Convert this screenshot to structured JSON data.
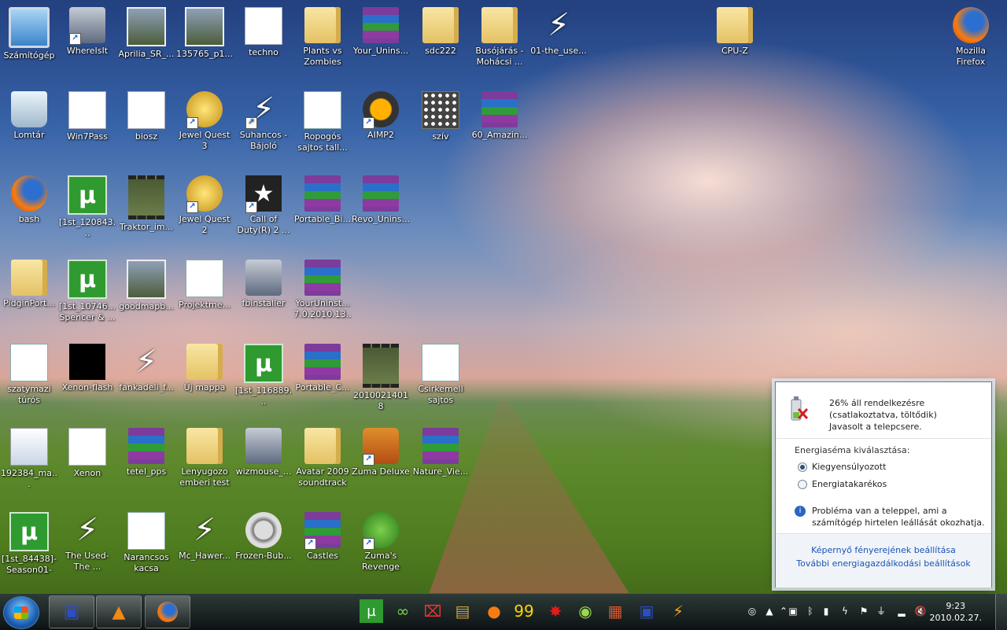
{
  "desktop": {
    "icons": [
      {
        "label": "Számítógép",
        "icon": "computer-icon"
      },
      {
        "label": "WhereIsIt",
        "icon": "disk-app-icon"
      },
      {
        "label": "Aprilia_SR_...",
        "icon": "photo-icon"
      },
      {
        "label": "135765_p1...",
        "icon": "photo-icon"
      },
      {
        "label": "techno",
        "icon": "text-document-icon"
      },
      {
        "label": "Plants vs Zombies",
        "icon": "folder-icon"
      },
      {
        "label": "Your_Unins...",
        "icon": "winrar-archive-icon"
      },
      {
        "label": "sdc222",
        "icon": "folder-icon"
      },
      {
        "label": "Busójárás - Mohácsi ...",
        "icon": "folder-icon"
      },
      {
        "label": "01-the_use...",
        "icon": "winamp-media-icon"
      },
      {
        "label": "CPU-Z",
        "icon": "folder-icon"
      },
      {
        "label": "Mozilla Firefox",
        "icon": "firefox-icon"
      },
      {
        "label": "Lomtár",
        "icon": "recycle-bin-icon"
      },
      {
        "label": "Win7Pass",
        "icon": "text-document-icon"
      },
      {
        "label": "biosz",
        "icon": "text-document-icon"
      },
      {
        "label": "Jewel Quest 3",
        "icon": "jewel-quest-icon"
      },
      {
        "label": "Suhancos - Bájoló",
        "icon": "winamp-media-icon"
      },
      {
        "label": "Ropogós sajtos tall...",
        "icon": "word-document-icon"
      },
      {
        "label": "AIMP2",
        "icon": "aimp-icon"
      },
      {
        "label": "szív",
        "icon": "pattern-image-icon"
      },
      {
        "label": "60_Amazin...",
        "icon": "winrar-archive-icon"
      },
      {
        "label": "bash",
        "icon": "firefox-file-icon"
      },
      {
        "label": "[1st_120843...",
        "icon": "utorrent-icon"
      },
      {
        "label": "Traktor_im...",
        "icon": "video-file-icon"
      },
      {
        "label": "Jewel Quest 2",
        "icon": "jewel-quest-icon"
      },
      {
        "label": "Call of Duty(R) 2 ...",
        "icon": "call-of-duty-icon"
      },
      {
        "label": "Portable_Bi...",
        "icon": "winrar-archive-icon"
      },
      {
        "label": "Revo_Unins...",
        "icon": "winrar-archive-icon"
      },
      {
        "label": "PidginPort...",
        "icon": "folder-icon"
      },
      {
        "label": "[1st_10746... Spencer & ...",
        "icon": "utorrent-icon"
      },
      {
        "label": "goodmapb...",
        "icon": "map-image-icon"
      },
      {
        "label": "Projektme...",
        "icon": "word-document-icon"
      },
      {
        "label": "fbinstaller",
        "icon": "installer-icon"
      },
      {
        "label": "YourUninst... 7.0.2010.13...",
        "icon": "winrar-archive-icon"
      },
      {
        "label": "szatymazi túrós",
        "icon": "word-document-icon"
      },
      {
        "label": "Xenon-flash",
        "icon": "black-image-icon"
      },
      {
        "label": "fankadeli_f...",
        "icon": "winamp-media-icon"
      },
      {
        "label": "Új mappa",
        "icon": "folder-icon"
      },
      {
        "label": "[1st_116889...",
        "icon": "utorrent-icon"
      },
      {
        "label": "Portable_C...",
        "icon": "winrar-archive-icon"
      },
      {
        "label": "20100214018",
        "icon": "video-file-icon"
      },
      {
        "label": "Csirkemell sajtos",
        "icon": "word-document-icon"
      },
      {
        "label": "192384_ma...",
        "icon": "portrait-image-icon"
      },
      {
        "label": "Xenon",
        "icon": "audio-file-icon"
      },
      {
        "label": "tetel_pps",
        "icon": "winrar-archive-icon"
      },
      {
        "label": "Lenyugozo emberi test",
        "icon": "folder-icon"
      },
      {
        "label": "wizmouse_...",
        "icon": "installer-icon"
      },
      {
        "label": "Avatar 2009 soundtrack",
        "icon": "folder-icon"
      },
      {
        "label": "Zuma Deluxe",
        "icon": "zuma-icon"
      },
      {
        "label": "Nature_Vie...",
        "icon": "winrar-archive-icon"
      },
      {
        "label": "[1st_84438]- Season01-S...",
        "icon": "utorrent-icon"
      },
      {
        "label": "The Used-The ...",
        "icon": "winamp-media-icon"
      },
      {
        "label": "Narancsos kacsa",
        "icon": "word-document-icon"
      },
      {
        "label": "Mc_Hawer...",
        "icon": "winamp-media-icon"
      },
      {
        "label": "Frozen-Bub...",
        "icon": "gears-icon"
      },
      {
        "label": "Castles",
        "icon": "winrar-archive-icon"
      },
      {
        "label": "Zuma's Revenge",
        "icon": "zumas-revenge-icon"
      }
    ]
  },
  "taskbar": {
    "start_label": "Start",
    "pinned": [
      {
        "icon": "floppy-save-icon"
      },
      {
        "icon": "vlc-icon"
      },
      {
        "icon": "firefox-icon"
      }
    ],
    "quick_launch": [
      {
        "icon": "utorrent-icon"
      },
      {
        "icon": "infinity-icon"
      },
      {
        "icon": "uninstaller-icon"
      },
      {
        "icon": "archive-icon"
      },
      {
        "icon": "firefox-icon"
      },
      {
        "icon": "monitor-99-icon"
      },
      {
        "icon": "red-splat-icon"
      },
      {
        "icon": "lime-icon"
      },
      {
        "icon": "castle-icon"
      },
      {
        "icon": "floppy-save-icon"
      },
      {
        "icon": "winamp-icon"
      }
    ],
    "tray": [
      {
        "icon": "network-status-icon"
      },
      {
        "icon": "vlc-tray-icon"
      },
      {
        "icon": "hidden-icons-icon"
      },
      {
        "icon": "device-icon"
      },
      {
        "icon": "bluetooth-icon"
      },
      {
        "icon": "battery-plug-icon"
      },
      {
        "icon": "lightning-icon"
      },
      {
        "icon": "action-center-flag-icon"
      },
      {
        "icon": "power-plug-icon"
      },
      {
        "icon": "signal-bars-icon"
      },
      {
        "icon": "volume-muted-icon"
      }
    ],
    "clock": {
      "time": "9:23",
      "date": "2010.02.27."
    }
  },
  "power_popup": {
    "status_line1": "26% áll rendelkezésre",
    "status_line2": "(csatlakoztatva, töltődik)",
    "status_line3": "Javasolt a telepcsere.",
    "scheme_title": "Energiaséma kiválasztása:",
    "schemes": [
      {
        "label": "Kiegyensúlyozott",
        "selected": true
      },
      {
        "label": "Energiatakarékos",
        "selected": false
      }
    ],
    "warning": "Probléma van a teleppel, ami a számítógép hirtelen leállását okozhatja.",
    "link_brightness": "Képernyő fényerejének beállítása",
    "link_more": "További energiagazdálkodási beállítások"
  }
}
